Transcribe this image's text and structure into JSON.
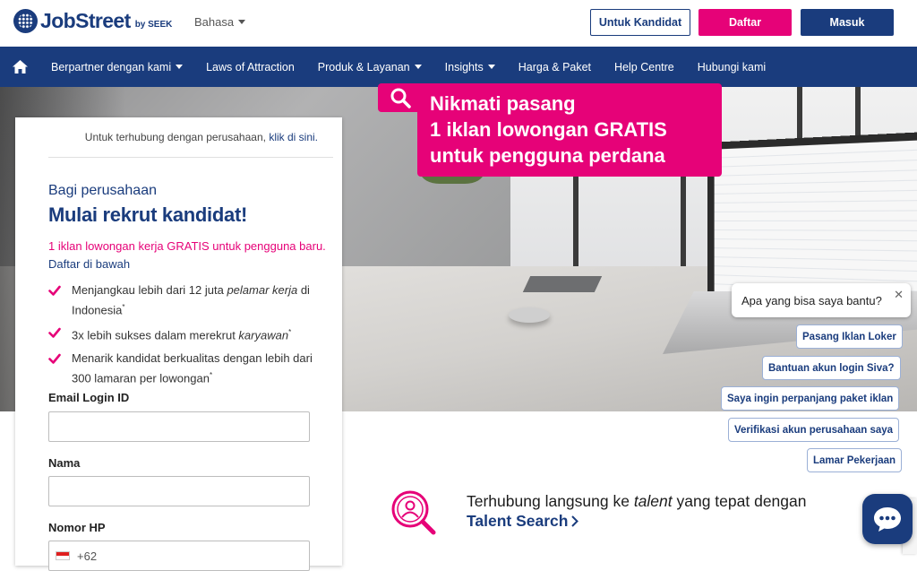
{
  "header": {
    "logo_text": "JobStreet",
    "logo_by": "by SEEK",
    "language": "Bahasa",
    "candidate_button": "Untuk Kandidat",
    "register_button": "Daftar",
    "login_button": "Masuk"
  },
  "nav": {
    "items": [
      {
        "label": "Berpartner dengan kami",
        "dropdown": true
      },
      {
        "label": "Laws of Attraction",
        "dropdown": false
      },
      {
        "label": "Produk & Layanan",
        "dropdown": true
      },
      {
        "label": "Insights",
        "dropdown": true
      },
      {
        "label": "Harga & Paket",
        "dropdown": false
      },
      {
        "label": "Help Centre",
        "dropdown": false
      },
      {
        "label": "Hubungi kami",
        "dropdown": false
      }
    ]
  },
  "hero": {
    "promo_lines": [
      "Nikmati pasang",
      "1 iklan lowongan GRATIS",
      "untuk pengguna perdana"
    ]
  },
  "form": {
    "connect_text": "Untuk terhubung dengan perusahaan,",
    "connect_link": "klik di sini.",
    "subtitle": "Bagi perusahaan",
    "title": "Mulai rekrut kandidat!",
    "promo": "1 iklan lowongan kerja GRATIS untuk pengguna baru.",
    "promo_link": "Daftar di bawah",
    "benefits": [
      {
        "pre": "Menjangkau lebih dari 12 juta ",
        "em": "pelamar kerja",
        "post": " di Indonesia"
      },
      {
        "pre": "3x lebih sukses dalam merekrut ",
        "em": "karyawan",
        "post": ""
      },
      {
        "pre": "Menarik kandidat berkualitas dengan lebih dari 300 lamaran per lowongan",
        "em": "",
        "post": ""
      }
    ],
    "email_label": "Email Login ID",
    "email_value": "",
    "name_label": "Nama",
    "name_value": "",
    "phone_label": "Nomor HP",
    "phone_prefix": "+62"
  },
  "talent": {
    "title_pre": "Terhubung langsung ke ",
    "title_em": "talent",
    "title_post": " yang tepat dengan",
    "link": "Talent Search"
  },
  "chat": {
    "question": "Apa yang bisa saya bantu?",
    "options": [
      "Pasang Iklan Loker",
      "Bantuan akun login Siva?",
      "Saya ingin perpanjang paket iklan",
      "Verifikasi akun perusahaan saya",
      "Lamar Pekerjaan"
    ]
  },
  "colors": {
    "brand_navy": "#1a3c7d",
    "brand_pink": "#e60278"
  }
}
